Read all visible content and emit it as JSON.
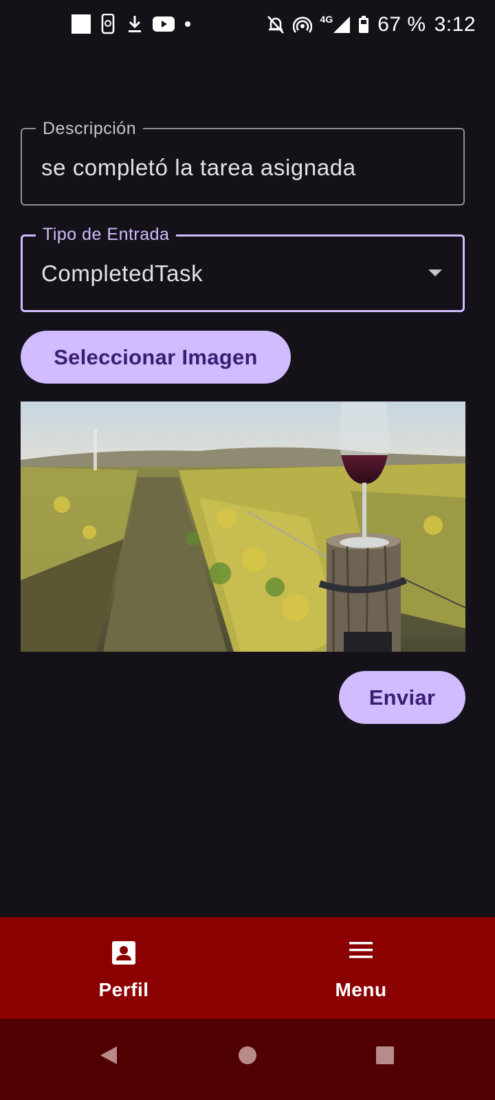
{
  "status_bar": {
    "battery": "67 %",
    "time": "3:12",
    "network": "4G",
    "icons_left": [
      "square-notification-icon",
      "phone-sync-icon",
      "download-icon",
      "youtube-icon",
      "dot-icon"
    ],
    "icons_right": [
      "notifications-off-icon",
      "hotspot-icon",
      "signal-icon",
      "battery-icon"
    ]
  },
  "form": {
    "description": {
      "label": "Descripción",
      "value": "se completó la tarea asignada"
    },
    "entry_type": {
      "label": "Tipo de Entrada",
      "value": "CompletedTask"
    },
    "select_image_label": "Seleccionar Imagen",
    "send_label": "Enviar"
  },
  "bottom_nav": {
    "items": [
      {
        "label": "Perfil",
        "icon": "profile-icon"
      },
      {
        "label": "Menu",
        "icon": "menu-icon"
      }
    ]
  },
  "system_nav": {
    "icons": [
      "back-icon",
      "home-icon",
      "recents-icon"
    ]
  },
  "colors": {
    "background": "#141218",
    "accent": "#d0bcff",
    "button_text": "#381e72",
    "bottom_nav": "#8b0000",
    "system_nav": "#500000"
  }
}
